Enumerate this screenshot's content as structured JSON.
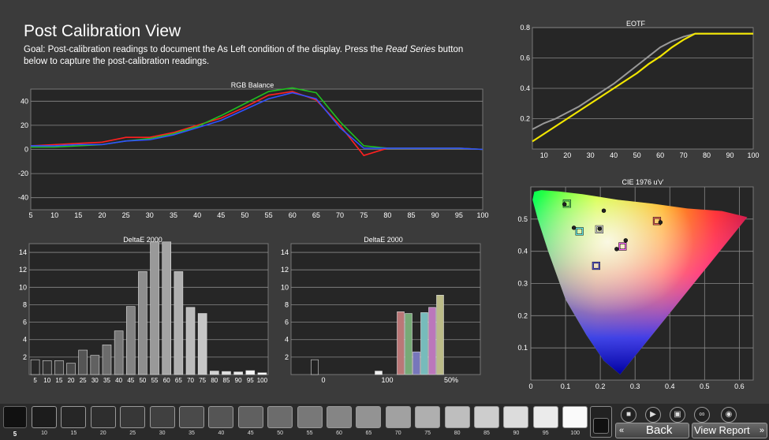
{
  "page": {
    "title": "Post Calibration View",
    "goal_prefix": "Goal: Post-calibration readings to document the As Left condition of the display. Press the ",
    "goal_italic": "Read Series",
    "goal_suffix": " button below to capture the post-calibration readings."
  },
  "chart_data": [
    {
      "id": "rgb",
      "type": "line",
      "title": "RGB Balance",
      "x": [
        5,
        10,
        15,
        20,
        25,
        30,
        35,
        40,
        45,
        50,
        55,
        60,
        65,
        70,
        75,
        80,
        85,
        90,
        95,
        100
      ],
      "xticks": [
        5,
        10,
        15,
        20,
        25,
        30,
        35,
        40,
        45,
        50,
        55,
        60,
        65,
        70,
        75,
        80,
        85,
        90,
        95,
        100
      ],
      "yticks": [
        40,
        20,
        0,
        -20,
        -40
      ],
      "ylim": [
        -50,
        50
      ],
      "series": [
        {
          "color": "#ff2020",
          "values": [
            3,
            4,
            5,
            6,
            10,
            10,
            14,
            20,
            26,
            35,
            45,
            48,
            41,
            20,
            -5,
            1,
            1,
            1,
            1,
            0
          ]
        },
        {
          "color": "#20c020",
          "values": [
            2,
            2,
            3,
            4,
            7,
            9,
            13,
            19,
            28,
            38,
            48,
            51,
            47,
            23,
            3,
            1,
            1,
            1,
            1,
            0
          ]
        },
        {
          "color": "#3050ff",
          "values": [
            3,
            3,
            4,
            4,
            7,
            8,
            12,
            18,
            24,
            33,
            42,
            47,
            42,
            18,
            1,
            1,
            1,
            1,
            1,
            0
          ]
        }
      ]
    },
    {
      "id": "de1",
      "type": "bar",
      "title": "DeltaE 2000",
      "categories": [
        "5",
        "10",
        "15",
        "20",
        "25",
        "30",
        "35",
        "40",
        "45",
        "50",
        "55",
        "60",
        "65",
        "70",
        "75",
        "80",
        "85",
        "90",
        "95",
        "100"
      ],
      "values": [
        1.7,
        1.6,
        1.6,
        1.3,
        2.8,
        2.2,
        3.4,
        5.0,
        7.8,
        11.8,
        15.2,
        15.2,
        11.8,
        7.7,
        7.0,
        0.4,
        0.35,
        0.3,
        0.45,
        0.2
      ],
      "yticks": [
        14,
        12,
        10,
        8,
        6,
        4,
        2
      ],
      "ylim": [
        0,
        15
      ]
    },
    {
      "id": "de2",
      "type": "bar",
      "title": "DeltaE 2000",
      "xticks": [
        "0",
        "100",
        "50%"
      ],
      "bars": [
        {
          "x": 30,
          "value": 1.7,
          "color": "#222222"
        },
        {
          "x": 111,
          "value": 0.4,
          "color": "#eeeeee"
        },
        {
          "x": 139,
          "value": 7.2,
          "color": "#bb7777"
        },
        {
          "x": 149,
          "value": 7.0,
          "color": "#77aa77"
        },
        {
          "x": 159,
          "value": 2.6,
          "color": "#7777bb"
        },
        {
          "x": 169,
          "value": 7.1,
          "color": "#77bbbb"
        },
        {
          "x": 179,
          "value": 7.7,
          "color": "#bb77bb"
        },
        {
          "x": 189,
          "value": 9.1,
          "color": "#bbbb88"
        }
      ],
      "yticks": [
        14,
        12,
        10,
        8,
        6,
        4,
        2
      ],
      "ylim": [
        0,
        15
      ]
    },
    {
      "id": "eotf",
      "type": "line",
      "title": "EOTF",
      "x": [
        5,
        10,
        15,
        20,
        25,
        30,
        35,
        40,
        45,
        50,
        55,
        60,
        65,
        70,
        75,
        80,
        85,
        90,
        95,
        100
      ],
      "xticks": [
        10,
        20,
        30,
        40,
        50,
        60,
        70,
        80,
        90,
        100
      ],
      "yticks": [
        0.8,
        0.6,
        0.4,
        0.2
      ],
      "ylim": [
        0,
        0.8
      ],
      "series": [
        {
          "color": "#999999",
          "values": [
            0.13,
            0.17,
            0.2,
            0.24,
            0.28,
            0.33,
            0.38,
            0.43,
            0.49,
            0.55,
            0.61,
            0.67,
            0.71,
            0.74,
            0.76,
            0.76,
            0.76,
            0.76,
            0.76,
            0.76
          ]
        },
        {
          "color": "#f2e600",
          "values": [
            0.05,
            0.1,
            0.15,
            0.2,
            0.25,
            0.3,
            0.35,
            0.4,
            0.45,
            0.5,
            0.56,
            0.61,
            0.67,
            0.72,
            0.76,
            0.76,
            0.76,
            0.76,
            0.76,
            0.76
          ]
        }
      ]
    },
    {
      "id": "cie",
      "type": "scatter",
      "title": "CIE 1976 u'v'",
      "xticks": [
        0,
        0.1,
        0.2,
        0.3,
        0.4,
        0.5,
        0.6
      ],
      "yticks": [
        0.5,
        0.4,
        0.3,
        0.2,
        0.1
      ],
      "xlim": [
        0,
        0.64
      ],
      "ylim": [
        0,
        0.6
      ],
      "targets": [
        {
          "u": 0.104,
          "v": 0.548,
          "color": "#6cff6c"
        },
        {
          "u": 0.14,
          "v": 0.462,
          "color": "#6cffff"
        },
        {
          "u": 0.197,
          "v": 0.468,
          "color": "#ffffff"
        },
        {
          "u": 0.363,
          "v": 0.494,
          "color": "#ff6666"
        },
        {
          "u": 0.264,
          "v": 0.415,
          "color": "#ff66ff"
        },
        {
          "u": 0.188,
          "v": 0.355,
          "color": "#6666ff"
        }
      ],
      "measured": [
        {
          "u": 0.097,
          "v": 0.546
        },
        {
          "u": 0.124,
          "v": 0.473
        },
        {
          "u": 0.21,
          "v": 0.526
        },
        {
          "u": 0.198,
          "v": 0.47
        },
        {
          "u": 0.373,
          "v": 0.49
        },
        {
          "u": 0.273,
          "v": 0.434
        },
        {
          "u": 0.247,
          "v": 0.407
        }
      ]
    }
  ],
  "bottom": {
    "selected_label": "5",
    "swatches": [
      {
        "label": "10",
        "gray": "#1c1c1c"
      },
      {
        "label": "15",
        "gray": "#262626"
      },
      {
        "label": "20",
        "gray": "#2e2e2e"
      },
      {
        "label": "25",
        "gray": "#373737"
      },
      {
        "label": "30",
        "gray": "#404040"
      },
      {
        "label": "35",
        "gray": "#4a4a4a"
      },
      {
        "label": "40",
        "gray": "#555555"
      },
      {
        "label": "45",
        "gray": "#606060"
      },
      {
        "label": "50",
        "gray": "#6c6c6c"
      },
      {
        "label": "55",
        "gray": "#787878"
      },
      {
        "label": "60",
        "gray": "#858585"
      },
      {
        "label": "65",
        "gray": "#939393"
      },
      {
        "label": "70",
        "gray": "#a1a1a1"
      },
      {
        "label": "75",
        "gray": "#afafaf"
      },
      {
        "label": "80",
        "gray": "#bebebe"
      },
      {
        "label": "85",
        "gray": "#cdcdcd"
      },
      {
        "label": "90",
        "gray": "#dcdcdc"
      },
      {
        "label": "95",
        "gray": "#ebebeb"
      },
      {
        "label": "100",
        "gray": "#fafafa"
      }
    ],
    "back_label": "Back",
    "view_report_label": "View Report"
  }
}
